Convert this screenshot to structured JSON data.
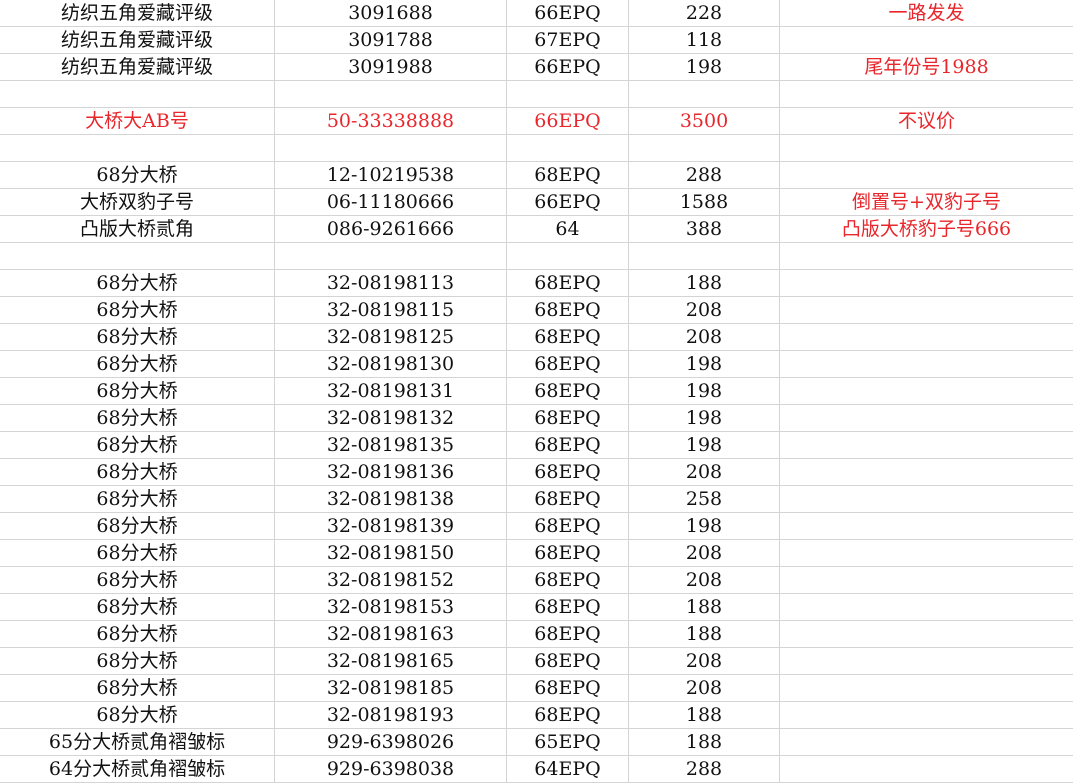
{
  "colors": {
    "text": "#111111",
    "highlight": "#e8262b",
    "grid": "#d4d4d4"
  },
  "rows": [
    {
      "name": "纺织五角爱藏评级",
      "serial": "3091688",
      "grade": "66EPQ",
      "price": "228",
      "note": "一路发发",
      "red": false,
      "note_red": true
    },
    {
      "name": "纺织五角爱藏评级",
      "serial": "3091788",
      "grade": "67EPQ",
      "price": "118",
      "note": "",
      "red": false,
      "note_red": false
    },
    {
      "name": "纺织五角爱藏评级",
      "serial": "3091988",
      "grade": "66EPQ",
      "price": "198",
      "note": "尾年份号1988",
      "red": false,
      "note_red": true
    },
    {
      "name": "",
      "serial": "",
      "grade": "",
      "price": "",
      "note": "",
      "red": false,
      "note_red": false
    },
    {
      "name": "大桥大AB号",
      "serial": "50-33338888",
      "grade": "66EPQ",
      "price": "3500",
      "note": "不议价",
      "red": true,
      "note_red": true
    },
    {
      "name": "",
      "serial": "",
      "grade": "",
      "price": "",
      "note": "",
      "red": false,
      "note_red": false
    },
    {
      "name": "68分大桥",
      "serial": "12-10219538",
      "grade": "68EPQ",
      "price": "288",
      "note": "",
      "red": false,
      "note_red": false
    },
    {
      "name": "大桥双豹子号",
      "serial": "06-11180666",
      "grade": "66EPQ",
      "price": "1588",
      "note": "倒置号+双豹子号",
      "red": false,
      "note_red": true
    },
    {
      "name": "凸版大桥贰角",
      "serial": "086-9261666",
      "grade": "64",
      "price": "388",
      "note": "凸版大桥豹子号666",
      "red": false,
      "note_red": true
    },
    {
      "name": "",
      "serial": "",
      "grade": "",
      "price": "",
      "note": "",
      "red": false,
      "note_red": false
    },
    {
      "name": "68分大桥",
      "serial": "32-08198113",
      "grade": "68EPQ",
      "price": "188",
      "note": "",
      "red": false,
      "note_red": false
    },
    {
      "name": "68分大桥",
      "serial": "32-08198115",
      "grade": "68EPQ",
      "price": "208",
      "note": "",
      "red": false,
      "note_red": false
    },
    {
      "name": "68分大桥",
      "serial": "32-08198125",
      "grade": "68EPQ",
      "price": "208",
      "note": "",
      "red": false,
      "note_red": false
    },
    {
      "name": "68分大桥",
      "serial": "32-08198130",
      "grade": "68EPQ",
      "price": "198",
      "note": "",
      "red": false,
      "note_red": false
    },
    {
      "name": "68分大桥",
      "serial": "32-08198131",
      "grade": "68EPQ",
      "price": "198",
      "note": "",
      "red": false,
      "note_red": false
    },
    {
      "name": "68分大桥",
      "serial": "32-08198132",
      "grade": "68EPQ",
      "price": "198",
      "note": "",
      "red": false,
      "note_red": false
    },
    {
      "name": "68分大桥",
      "serial": "32-08198135",
      "grade": "68EPQ",
      "price": "198",
      "note": "",
      "red": false,
      "note_red": false
    },
    {
      "name": "68分大桥",
      "serial": "32-08198136",
      "grade": "68EPQ",
      "price": "208",
      "note": "",
      "red": false,
      "note_red": false
    },
    {
      "name": "68分大桥",
      "serial": "32-08198138",
      "grade": "68EPQ",
      "price": "258",
      "note": "",
      "red": false,
      "note_red": false
    },
    {
      "name": "68分大桥",
      "serial": "32-08198139",
      "grade": "68EPQ",
      "price": "198",
      "note": "",
      "red": false,
      "note_red": false
    },
    {
      "name": "68分大桥",
      "serial": "32-08198150",
      "grade": "68EPQ",
      "price": "208",
      "note": "",
      "red": false,
      "note_red": false
    },
    {
      "name": "68分大桥",
      "serial": "32-08198152",
      "grade": "68EPQ",
      "price": "208",
      "note": "",
      "red": false,
      "note_red": false
    },
    {
      "name": "68分大桥",
      "serial": "32-08198153",
      "grade": "68EPQ",
      "price": "188",
      "note": "",
      "red": false,
      "note_red": false
    },
    {
      "name": "68分大桥",
      "serial": "32-08198163",
      "grade": "68EPQ",
      "price": "188",
      "note": "",
      "red": false,
      "note_red": false
    },
    {
      "name": "68分大桥",
      "serial": "32-08198165",
      "grade": "68EPQ",
      "price": "208",
      "note": "",
      "red": false,
      "note_red": false
    },
    {
      "name": "68分大桥",
      "serial": "32-08198185",
      "grade": "68EPQ",
      "price": "208",
      "note": "",
      "red": false,
      "note_red": false
    },
    {
      "name": "68分大桥",
      "serial": "32-08198193",
      "grade": "68EPQ",
      "price": "188",
      "note": "",
      "red": false,
      "note_red": false
    },
    {
      "name": "65分大桥贰角褶皱标",
      "serial": "929-6398026",
      "grade": "65EPQ",
      "price": "188",
      "note": "",
      "red": false,
      "note_red": false
    },
    {
      "name": "64分大桥贰角褶皱标",
      "serial": "929-6398038",
      "grade": "64EPQ",
      "price": "288",
      "note": "",
      "red": false,
      "note_red": false
    }
  ]
}
